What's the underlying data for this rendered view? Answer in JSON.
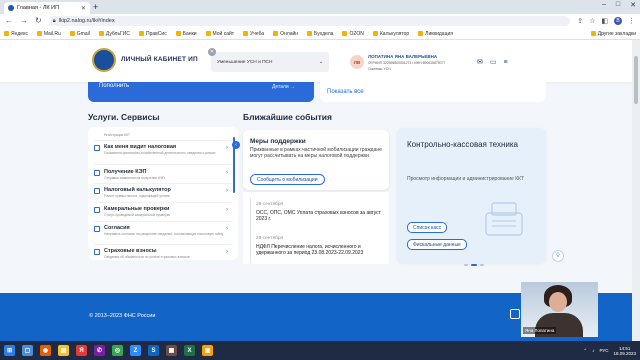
{
  "browser": {
    "tab_title": "Главная - ЛК ИП",
    "url": "lkip2.nalog.ru/lk#/index",
    "bookmarks": [
      "Яндекс",
      "Mail.Ru",
      "Gmail",
      "ДубльГИС",
      "ПравСис",
      "Банки",
      "Мой сайт",
      "Учеба",
      "Онлайн",
      "Бухдела",
      "OZON",
      "Калькулятор",
      "Ликвидация"
    ],
    "bookmarks_right": "Другие закладки",
    "profile_letter": "В"
  },
  "header": {
    "logo_text": "ЛИЧНЫЙ КАБИНЕТ ИП",
    "selector_value": "Уменьшение УСН и ПСН",
    "user_initials": "ЛВ",
    "user_name": "ЛОПАТИНА ЯНА ВАЛЕРЬЕВНА",
    "user_inn": "ОГРНИП 322595800001273 • ИНН 590615879077",
    "user_system": "Система: УСН"
  },
  "top_cards": {
    "replenish": "Пополнить",
    "details": "Детали →",
    "show_all": "Показать все"
  },
  "services": {
    "title": "Услуги. Сервисы",
    "items": [
      {
        "title": "",
        "desc": "Регистрация ККТ"
      },
      {
        "title": "Как меня видит налоговая",
        "desc": "Показатели финансово-хозяйственной деятельности, сведения о рисках"
      },
      {
        "title": "Получение КЭП",
        "desc": "Отправка заявления на получение КЭП"
      },
      {
        "title": "Налоговый калькулятор",
        "desc": "Расчёт суммы налога, подлежащей уплате"
      },
      {
        "title": "Камеральные проверки",
        "desc": "Статус проводимой камеральной проверки"
      },
      {
        "title": "Согласия",
        "desc": "Направить согласие на раскрытие сведений, составляющих налоговую тайну"
      },
      {
        "title": "Страховые взносы",
        "desc": "Сведения об обязанности по уплате страховых взносов"
      }
    ]
  },
  "events": {
    "title": "Ближайшие события",
    "card_title": "Меры поддержки",
    "card_desc": "Призванные в рамках частичной мобилизации граждане могут рассчитывать на меры налоговой поддержки",
    "card_button": "Сообщить о мобилизации",
    "list": [
      {
        "date": "28 сентября",
        "text": "ОСС, ОПС, ОМС Уплата страховых взносов за август 2023 г."
      },
      {
        "date": "28 сентября",
        "text": "НДФЛ Перечисление налога, исчисленного и удержанного за период 23.08.2023-22.09.2023"
      }
    ]
  },
  "kkt": {
    "title": "Контрольно-кассовая техника",
    "desc": "Просмотр информации и администрирование ККТ",
    "btn_list": "Список касс",
    "btn_fiscal": "Фискальные данные"
  },
  "footer": {
    "copyright": "© 2013–2023 ФНС России"
  },
  "webcam": {
    "name": "Яна Лопатина"
  },
  "taskbar": {
    "time": "14:51",
    "date": "18.09.2023",
    "lang": "РУС"
  }
}
